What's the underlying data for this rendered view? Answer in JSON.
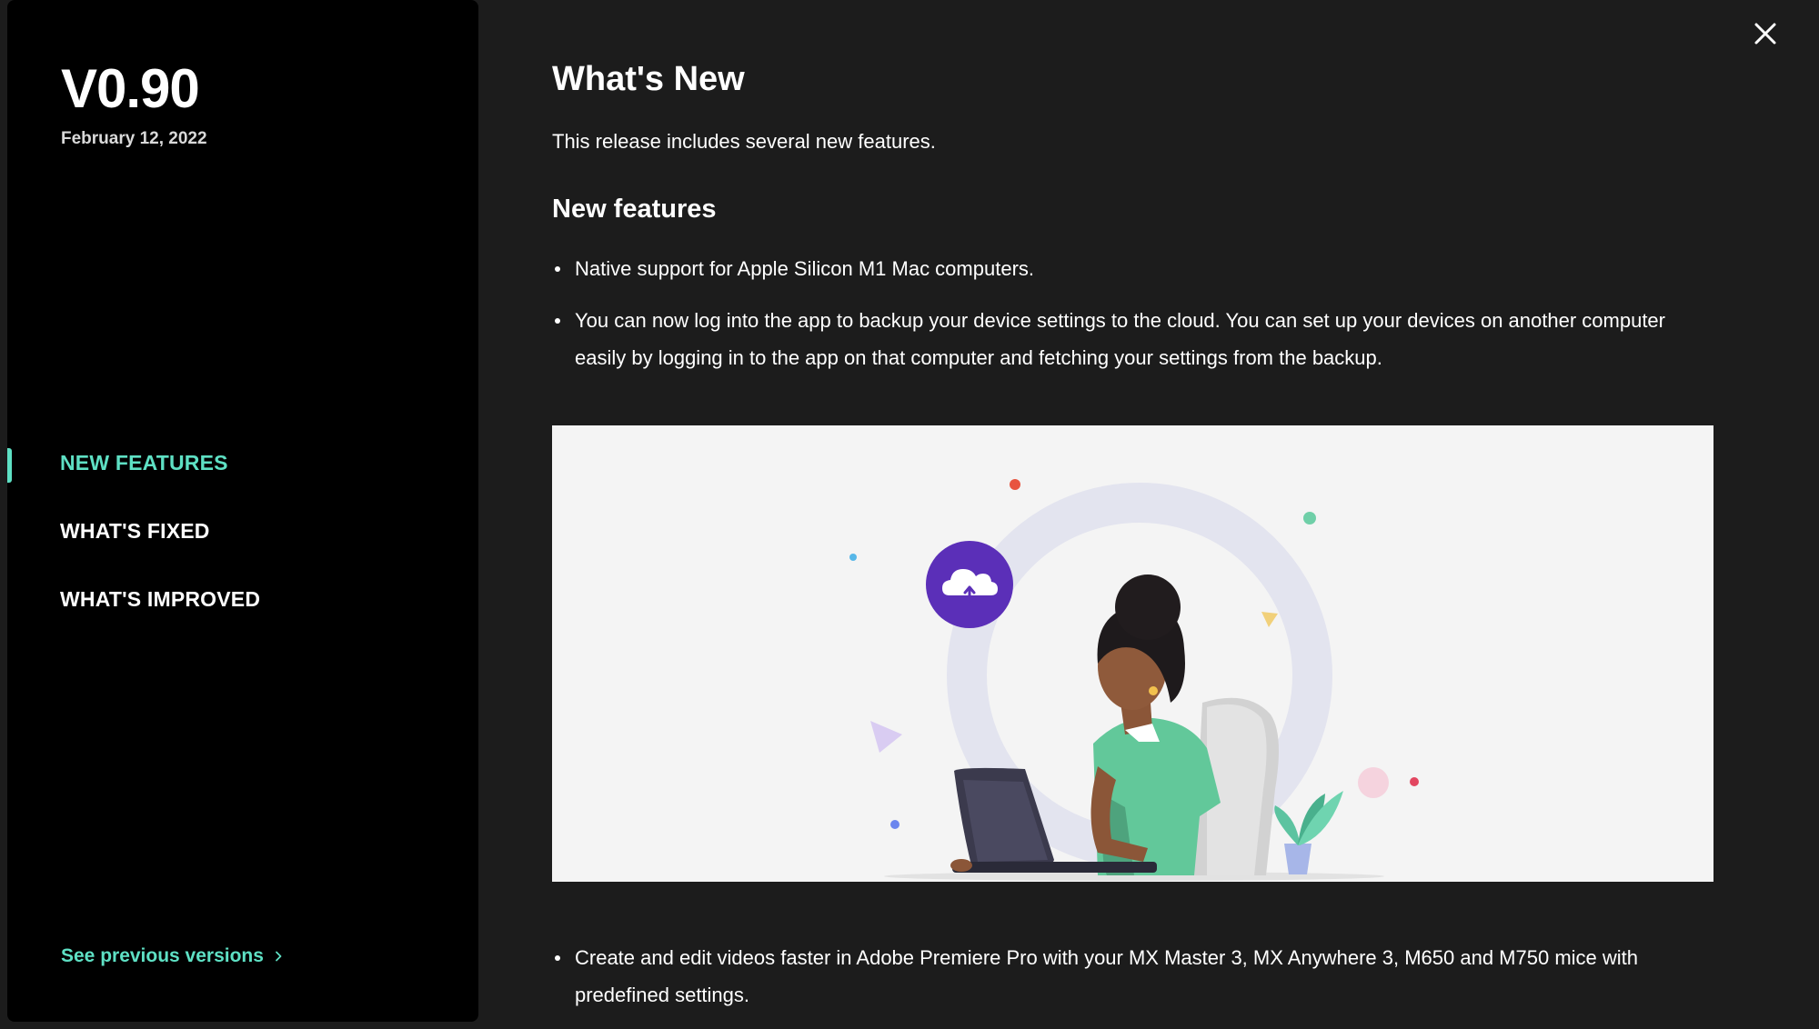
{
  "sidebar": {
    "version": "V0.90",
    "date": "February 12, 2022",
    "nav": [
      {
        "label": "NEW FEATURES",
        "active": true
      },
      {
        "label": "WHAT'S FIXED",
        "active": false
      },
      {
        "label": "WHAT'S IMPROVED",
        "active": false
      }
    ],
    "previous_versions_label": "See previous versions"
  },
  "main": {
    "title": "What's New",
    "intro": "This release includes several new features.",
    "section_title": "New features",
    "bullets": [
      "Native support for Apple Silicon M1 Mac computers.",
      "You can now log into the app to backup your device settings to the cloud. You can set up your devices on another computer easily by logging in to the app on that computer and fetching your settings from the backup."
    ],
    "bullets_after_image": [
      "Create and edit videos faster in Adobe Premiere Pro with your MX Master 3, MX Anywhere 3, M650 and M750 mice with predefined settings."
    ]
  },
  "icons": {
    "close": "close-icon",
    "chevron": "chevron-right-icon",
    "cloud_upload": "cloud-upload-icon"
  },
  "colors": {
    "accent": "#5ee0c4",
    "sidebar_bg": "#000000",
    "main_bg": "#1c1c1c",
    "text": "#ffffff",
    "cloud_badge": "#5b2fb8"
  }
}
